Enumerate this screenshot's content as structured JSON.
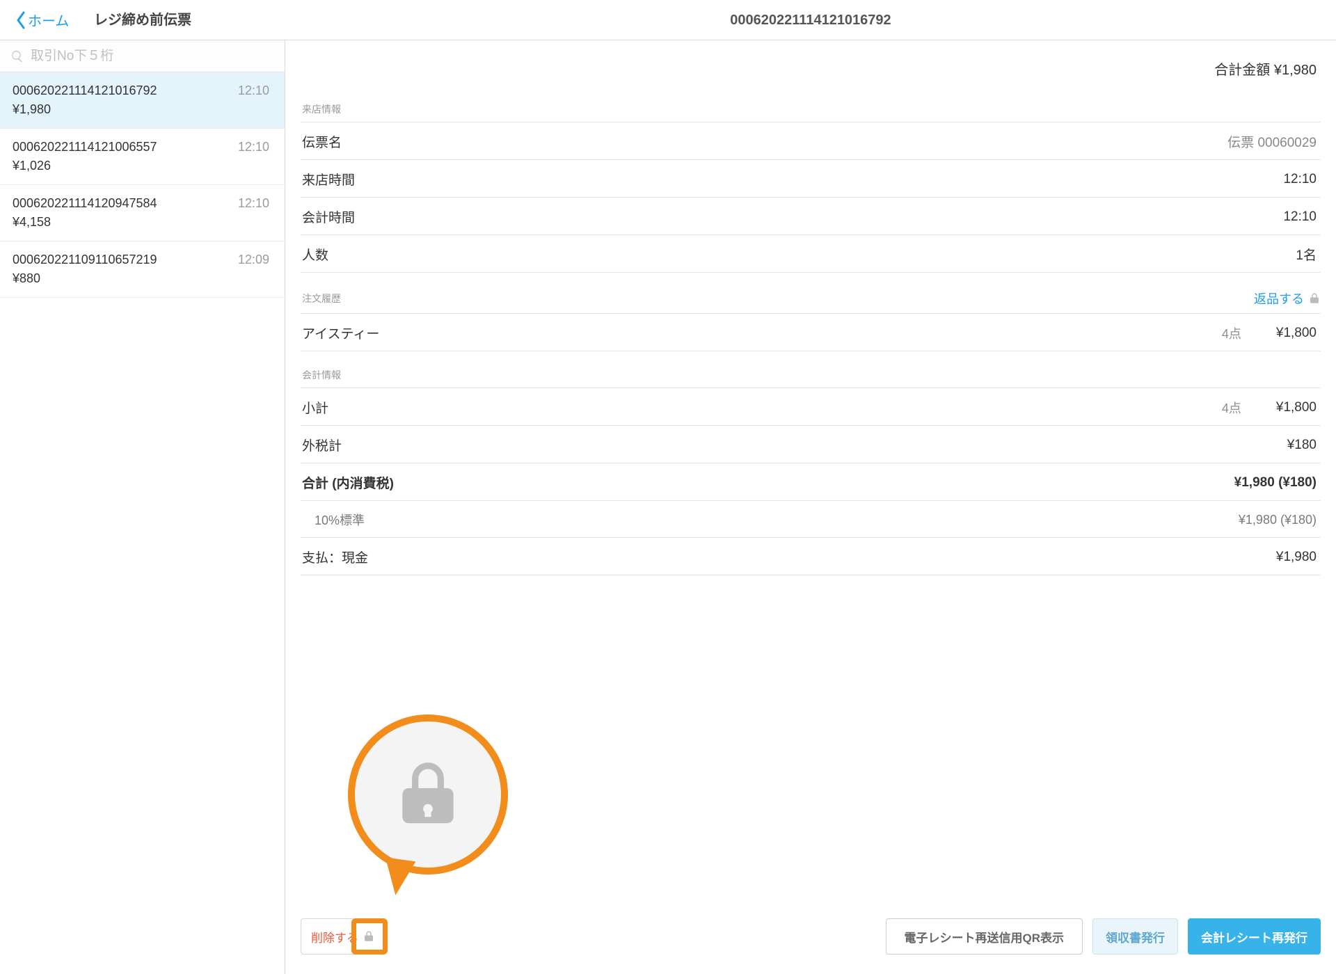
{
  "header": {
    "back_label": "ホーム",
    "sidebar_title": "レジ締め前伝票",
    "detail_title": "000620221114121016792"
  },
  "search": {
    "placeholder": "取引No下５桁"
  },
  "transactions": [
    {
      "id": "000620221114121016792",
      "amount": "¥1,980",
      "time": "12:10",
      "selected": true
    },
    {
      "id": "000620221114121006557",
      "amount": "¥1,026",
      "time": "12:10",
      "selected": false
    },
    {
      "id": "000620221114120947584",
      "amount": "¥4,158",
      "time": "12:10",
      "selected": false
    },
    {
      "id": "000620221109110657219",
      "amount": "¥880",
      "time": "12:09",
      "selected": false
    }
  ],
  "detail": {
    "total_label": "合計金額",
    "total_value": "¥1,980",
    "sections": {
      "visit": "来店情報",
      "orders": "注文履歴",
      "payment": "会計情報"
    },
    "return_label": "返品する",
    "visit_rows": {
      "slip_name_label": "伝票名",
      "slip_name_value": "伝票 00060029",
      "visit_time_label": "来店時間",
      "visit_time_value": "12:10",
      "checkout_time_label": "会計時間",
      "checkout_time_value": "12:10",
      "people_label": "人数",
      "people_value": "1名"
    },
    "order_rows": [
      {
        "name": "アイスティー",
        "qty": "4点",
        "amount": "¥1,800"
      }
    ],
    "payment_rows": {
      "subtotal_label": "小計",
      "subtotal_qty": "4点",
      "subtotal_value": "¥1,800",
      "ext_tax_label": "外税計",
      "ext_tax_value": "¥180",
      "total_label": "合計 (内消費税)",
      "total_value": "¥1,980 (¥180)",
      "standard_label": "10%標準",
      "standard_value": "¥1,980 (¥180)",
      "paid_label": "支払：現金",
      "paid_value": "¥1,980"
    }
  },
  "footer": {
    "delete": "削除する",
    "qr": "電子レシート再送信用QR表示",
    "receipt": "領収書発行",
    "reprint": "会計レシート再発行"
  }
}
